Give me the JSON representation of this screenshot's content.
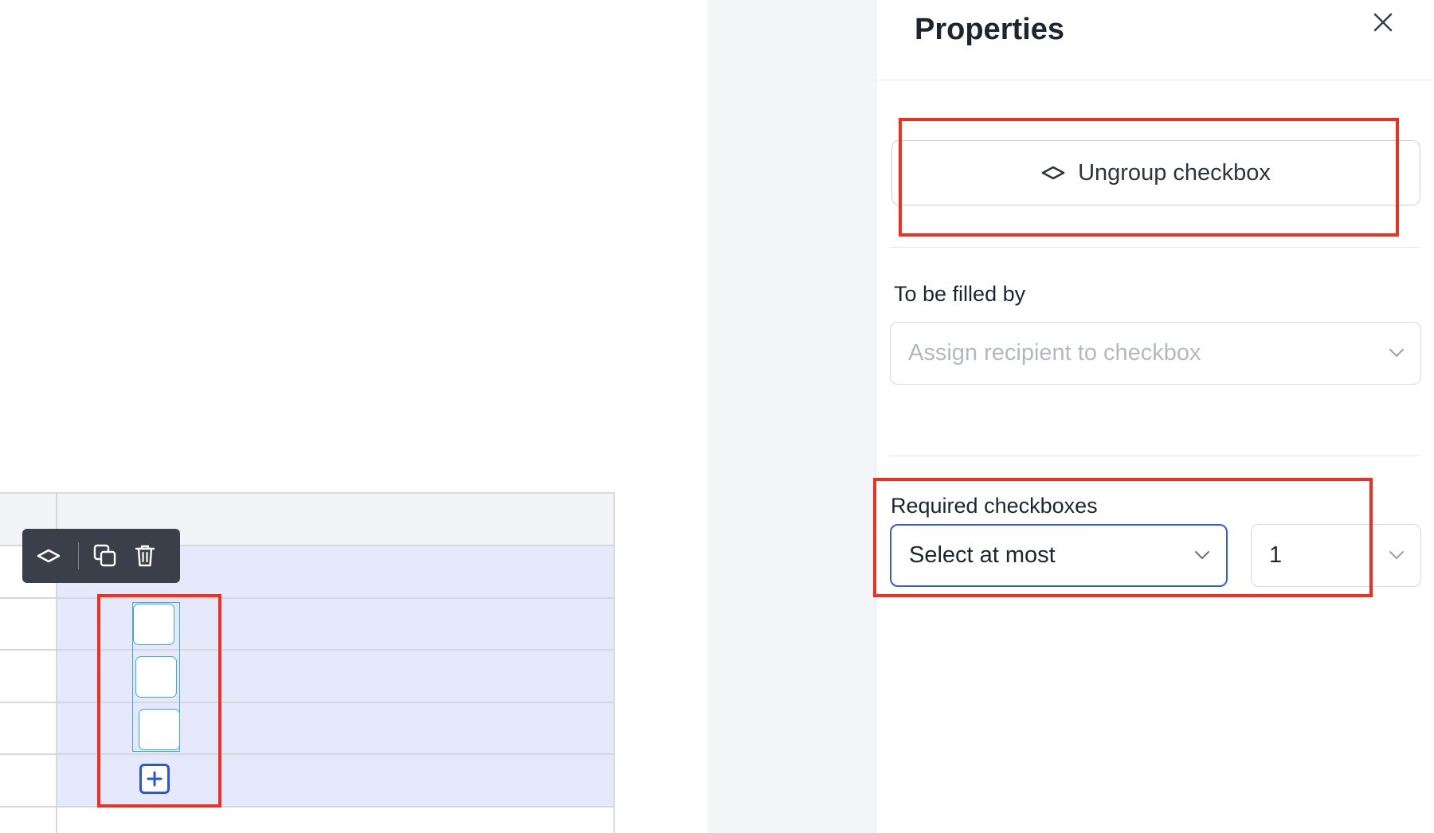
{
  "panel": {
    "title": "Properties",
    "ungroup_label": "Ungroup checkbox",
    "filled_by": {
      "label": "To be filled by",
      "placeholder": "Assign recipient to checkbox"
    },
    "required": {
      "label": "Required checkboxes",
      "mode_value": "Select at most",
      "count_value": "1"
    }
  },
  "toolbar": {
    "icons": [
      "ungroup-icon",
      "duplicate-icon",
      "trash-icon"
    ]
  },
  "canvas": {
    "checkbox_count": 3,
    "add_icon": "plus-icon"
  },
  "colors": {
    "accent": "#2f5ee5",
    "selection_bg": "#e6e8fc",
    "annotation": "#ef2f1f",
    "toolbar_bg": "#3a3f4a",
    "checkbox_border": "#39b3ad"
  }
}
